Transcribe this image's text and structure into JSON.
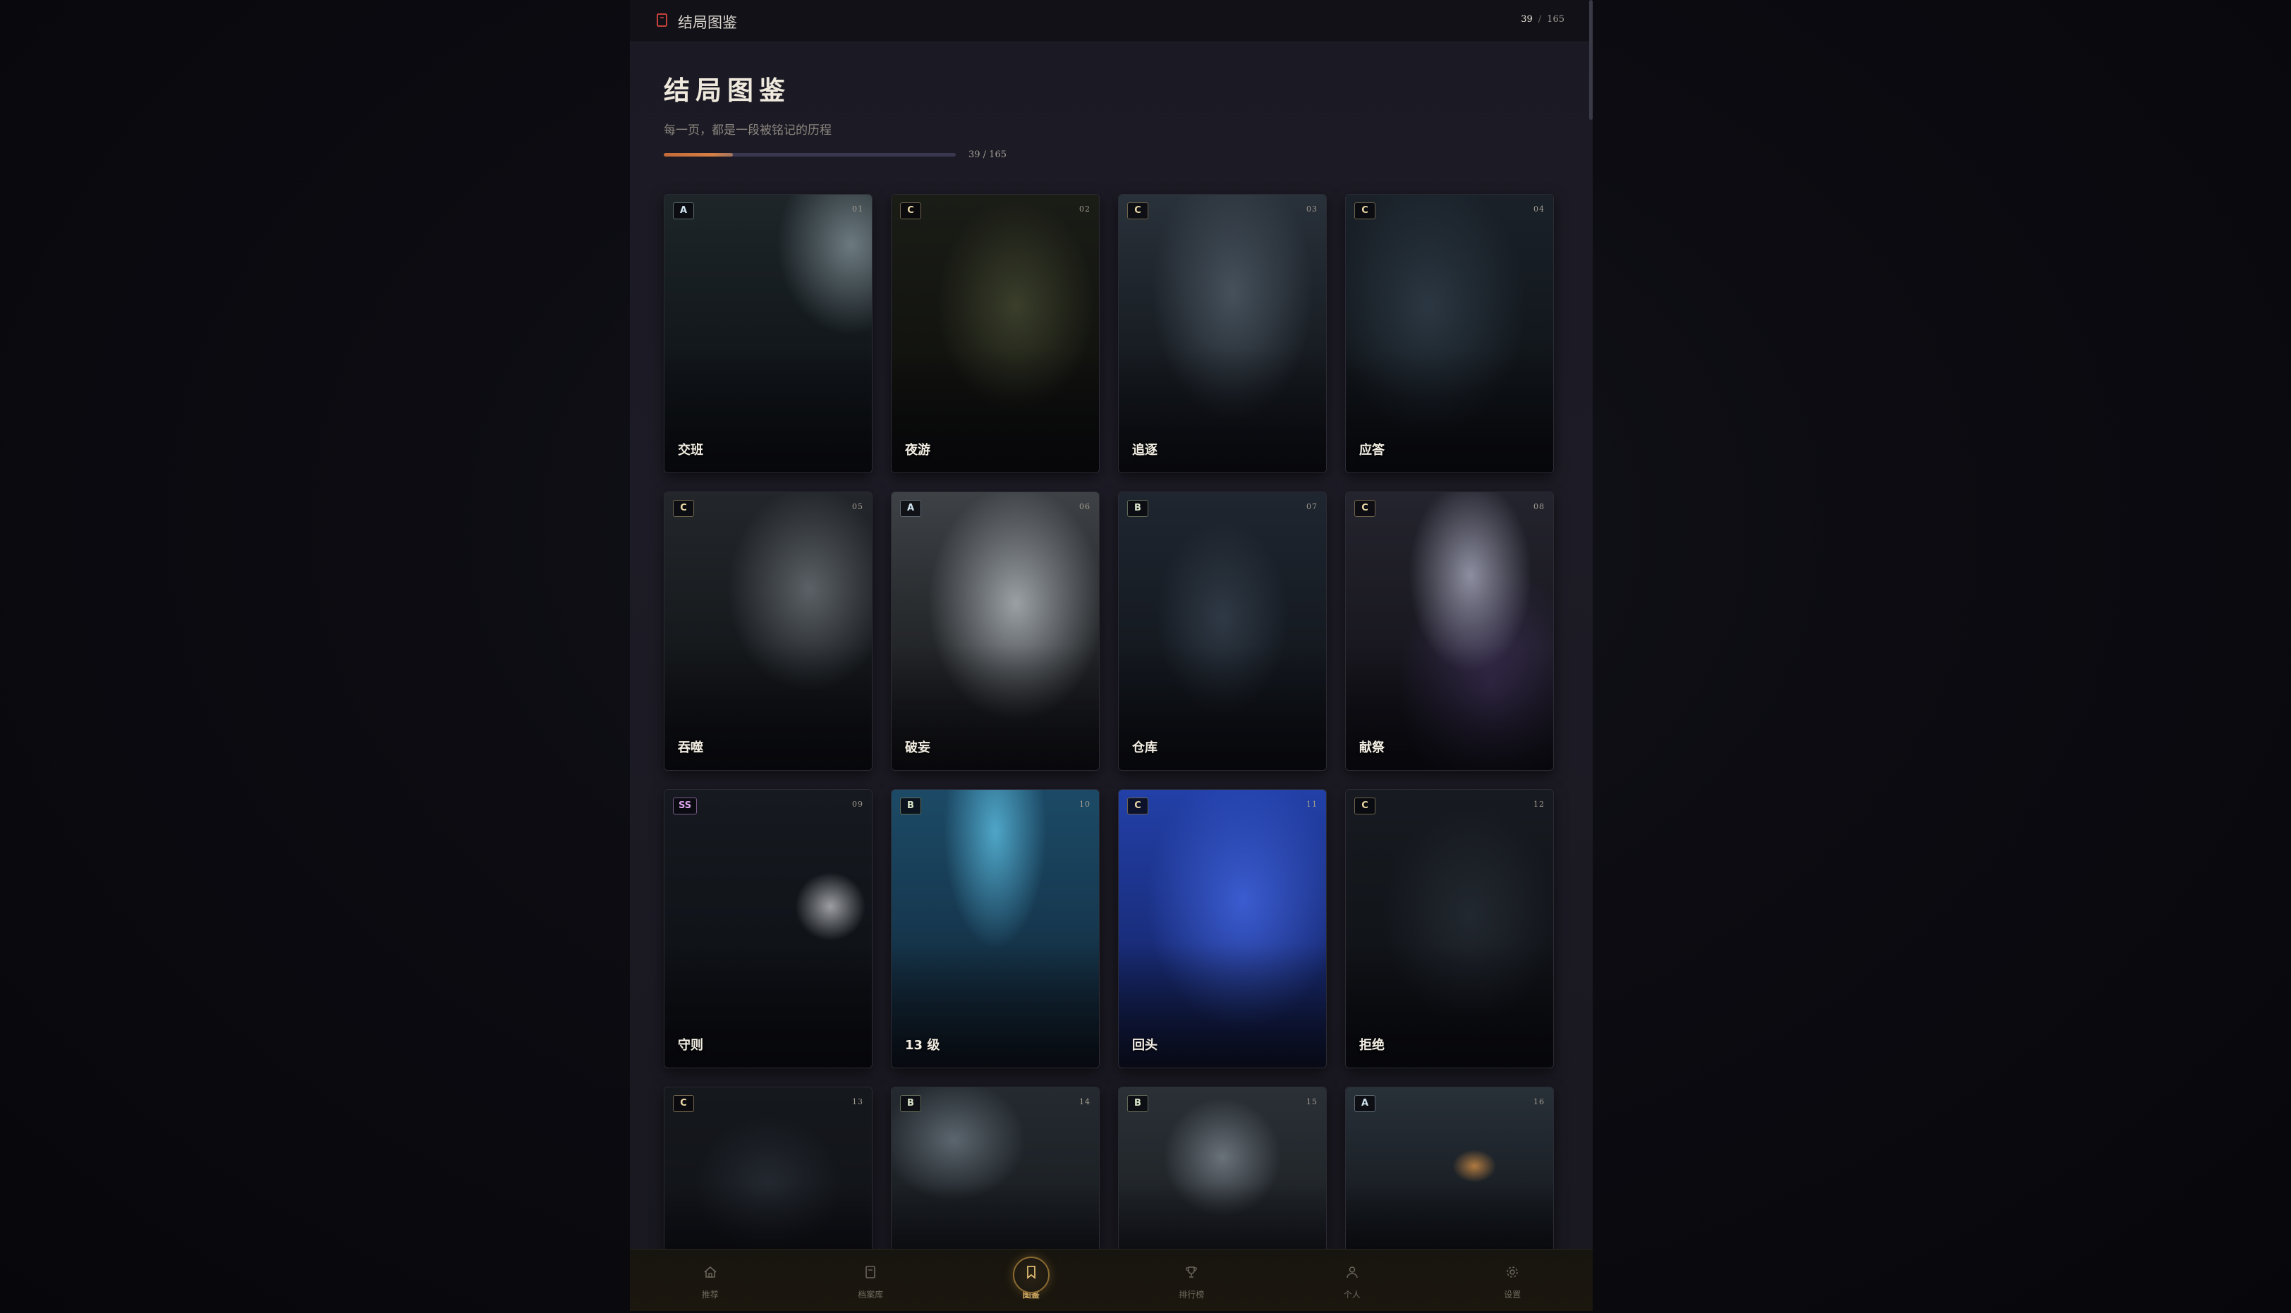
{
  "topbar": {
    "title": "结局图鉴",
    "current": "39",
    "total": "165"
  },
  "header": {
    "title": "结局图鉴",
    "subtitle": "每一页，都是一段被铭记的历程",
    "progress_label": "39 / 165",
    "progress": 0.2364
  },
  "cards": [
    {
      "rank": "A",
      "num": "01",
      "name": "交班"
    },
    {
      "rank": "C",
      "num": "02",
      "name": "夜游"
    },
    {
      "rank": "C",
      "num": "03",
      "name": "追逐"
    },
    {
      "rank": "C",
      "num": "04",
      "name": "应答"
    },
    {
      "rank": "C",
      "num": "05",
      "name": "吞噬"
    },
    {
      "rank": "A",
      "num": "06",
      "name": "破妄"
    },
    {
      "rank": "B",
      "num": "07",
      "name": "仓库"
    },
    {
      "rank": "C",
      "num": "08",
      "name": "献祭"
    },
    {
      "rank": "SS",
      "num": "09",
      "name": "守则"
    },
    {
      "rank": "B",
      "num": "10",
      "name": "13 级"
    },
    {
      "rank": "C",
      "num": "11",
      "name": "回头"
    },
    {
      "rank": "C",
      "num": "12",
      "name": "拒绝"
    },
    {
      "rank": "C",
      "num": "13",
      "name": ""
    },
    {
      "rank": "B",
      "num": "14",
      "name": ""
    },
    {
      "rank": "B",
      "num": "15",
      "name": ""
    },
    {
      "rank": "A",
      "num": "16",
      "name": ""
    }
  ],
  "tabs": [
    {
      "label": "推荐",
      "icon": "home-icon"
    },
    {
      "label": "档案库",
      "icon": "archive-icon"
    },
    {
      "label": "图鉴",
      "icon": "bookmark-icon",
      "active": true
    },
    {
      "label": "排行榜",
      "icon": "trophy-icon"
    },
    {
      "label": "个人",
      "icon": "user-icon"
    },
    {
      "label": "设置",
      "icon": "gear-icon"
    }
  ],
  "colors": {
    "accent": "#d8b26a",
    "progress": "#c46a3a",
    "background": "#1b1a24"
  }
}
